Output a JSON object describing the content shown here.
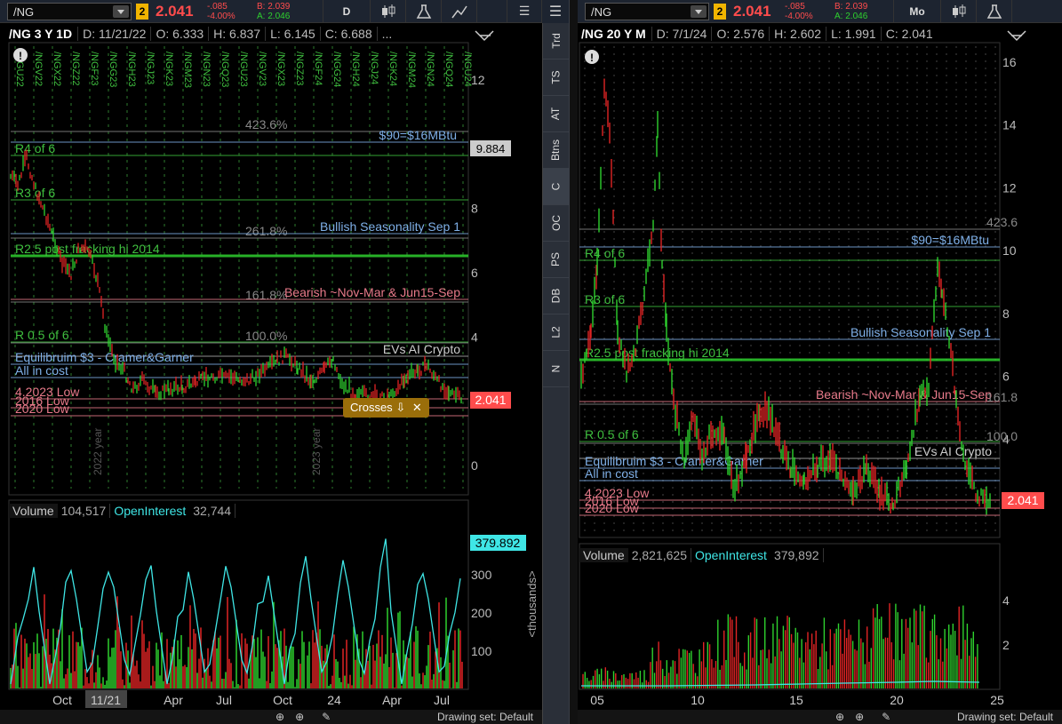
{
  "left": {
    "symbol": "/NG",
    "link": "2",
    "last": "2.041",
    "chg": "-.085",
    "chg_pct": "-4.00%",
    "bid": "B: 2.039",
    "ask": "A: 2.046",
    "aggregation": "D",
    "head": {
      "title": "/NG 3 Y 1D",
      "date": "D: 11/21/22",
      "open": "O: 6.333",
      "high": "H: 6.837",
      "low": "L: 6.145",
      "close": "C: 6.688",
      "more": "..."
    },
    "price_badge": "2.041",
    "ref_badge": "9.884",
    "y_ticks": [
      "12",
      "10",
      "8",
      "6",
      "4",
      "2",
      "0"
    ],
    "x_ticks": [
      "Oct",
      "11/21",
      "Apr",
      "Jul",
      "Oct",
      "24",
      "Apr",
      "Jul"
    ],
    "contracts": [
      "/NGU22",
      "/NGV22",
      "/NGX22",
      "/NGZ22",
      "/NGF23",
      "/NGG23",
      "/NGH23",
      "/NGJ23",
      "/NGK23",
      "/NGM23",
      "/NGN23",
      "/NGQ23",
      "/NGU23",
      "/NGV23",
      "/NGX23",
      "/NGZ23",
      "/NGF24",
      "/NGG24",
      "/NGH24",
      "/NGJ24",
      "/NGK24",
      "/NGM24",
      "/NGN24",
      "/NGQ24",
      "/NGU24"
    ],
    "levels": [
      {
        "label": "423.6%"
      },
      {
        "label": "$90=$16MBtu"
      },
      {
        "label": "R4 of 6"
      },
      {
        "label": "R3 of 6"
      },
      {
        "label": "261.8%"
      },
      {
        "label": "Bullish Seasonality Sep 1"
      },
      {
        "label": "R2.5 post fracking hi 2014"
      },
      {
        "label": "161.8%"
      },
      {
        "label": "Bearish ~Nov-Mar & Jun15-Sep"
      },
      {
        "label": "R 0.5 of 6"
      },
      {
        "label": "100.0%"
      },
      {
        "label": "EVs AI Crypto"
      },
      {
        "label": "Equilibruim $3 - Cramer&Garner"
      },
      {
        "label": "All in cost"
      },
      {
        "label": "4.2023 Low"
      },
      {
        "label": "2016 Low"
      },
      {
        "label": "2020 Low"
      }
    ],
    "year_labels": [
      "2022 year",
      "2023 year"
    ],
    "crosses_label": "Crosses",
    "volume": {
      "label": "Volume",
      "value": "104,517",
      "oi_label": "OpenInterest",
      "oi_value": "32,744",
      "badge": "379.892",
      "ticks": [
        "300",
        "200",
        "100"
      ],
      "unit": "<thousands>"
    },
    "drawing_set": "Drawing set: Default"
  },
  "right": {
    "symbol": "/NG",
    "link": "2",
    "last": "2.041",
    "chg": "-.085",
    "chg_pct": "-4.00%",
    "bid": "B: 2.039",
    "ask": "A: 2.046",
    "aggregation": "Mo",
    "head": {
      "title": "/NG 20 Y M",
      "date": "D: 7/1/24",
      "open": "O: 2.576",
      "high": "H: 2.602",
      "low": "L: 1.991",
      "close": "C: 2.041"
    },
    "price_badge": "2.041",
    "y_ticks": [
      "16",
      "14",
      "12",
      "10",
      "8",
      "6",
      "4",
      "2"
    ],
    "x_ticks": [
      "05",
      "10",
      "15",
      "20",
      "25"
    ],
    "levels": [
      {
        "label": "423.6"
      },
      {
        "label": "$90=$16MBtu"
      },
      {
        "label": "R4 of 6"
      },
      {
        "label": "R3 of 6"
      },
      {
        "label": "Bullish Seasonality Sep 1"
      },
      {
        "label": "R2.5 post fracking hi 2014"
      },
      {
        "label": "Bearish ~Nov-Mar & Jun15-Sep"
      },
      {
        "label": "161.8"
      },
      {
        "label": "R 0.5 of 6"
      },
      {
        "label": "100.0"
      },
      {
        "label": "EVs AI Crypto"
      },
      {
        "label": "Equilibruim $3 - Cramer&Garner"
      },
      {
        "label": "All in cost"
      },
      {
        "label": "4.2023 Low"
      },
      {
        "label": "2016 Low"
      },
      {
        "label": "2020 Low"
      }
    ],
    "volume": {
      "label": "Volume",
      "value": "2,821,625",
      "oi_label": "OpenInterest",
      "oi_value": "379,892",
      "ticks": [
        "4",
        "2"
      ]
    },
    "drawing_set": "Drawing set: Default"
  },
  "side_tabs": [
    "Trd",
    "TS",
    "AT",
    "Btns",
    "C",
    "OC",
    "PS",
    "DB",
    "L2",
    "N"
  ],
  "colors": {
    "up": "#2ed12e",
    "down": "#e02424",
    "oi": "#3fe6e6",
    "blue_level": "#7fb0e8",
    "green_level": "#3fbf3f",
    "red_level": "#e87a8a"
  }
}
